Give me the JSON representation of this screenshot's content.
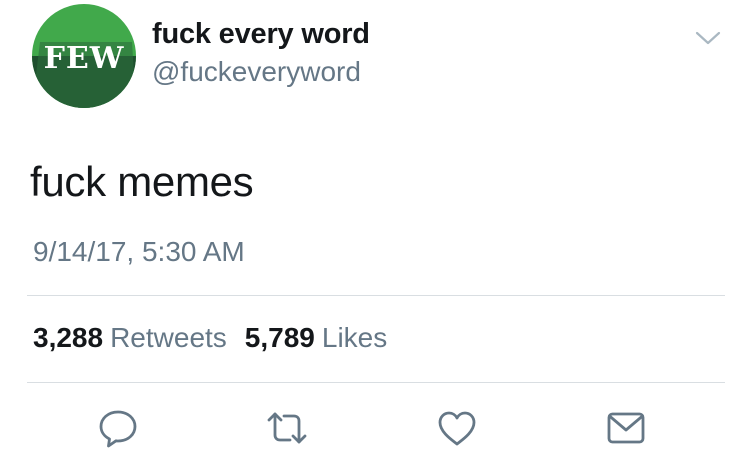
{
  "author": {
    "avatar_text": "FEW",
    "name": "fuck every word",
    "handle": "@fuckeveryword"
  },
  "tweet": {
    "text": "fuck memes",
    "timestamp": "9/14/17, 5:30 AM"
  },
  "stats": {
    "retweets_count": "3,288",
    "retweets_label": "Retweets",
    "likes_count": "5,789",
    "likes_label": "Likes"
  },
  "actions": [
    "reply-icon",
    "retweet-icon",
    "heart-icon",
    "direct-message-icon"
  ],
  "colors": {
    "avatar_light": "#41a94b",
    "avatar_dark": "#1e4f2e",
    "secondary_text": "#657786",
    "icon_gray": "#657786",
    "divider": "#d9dee2"
  }
}
